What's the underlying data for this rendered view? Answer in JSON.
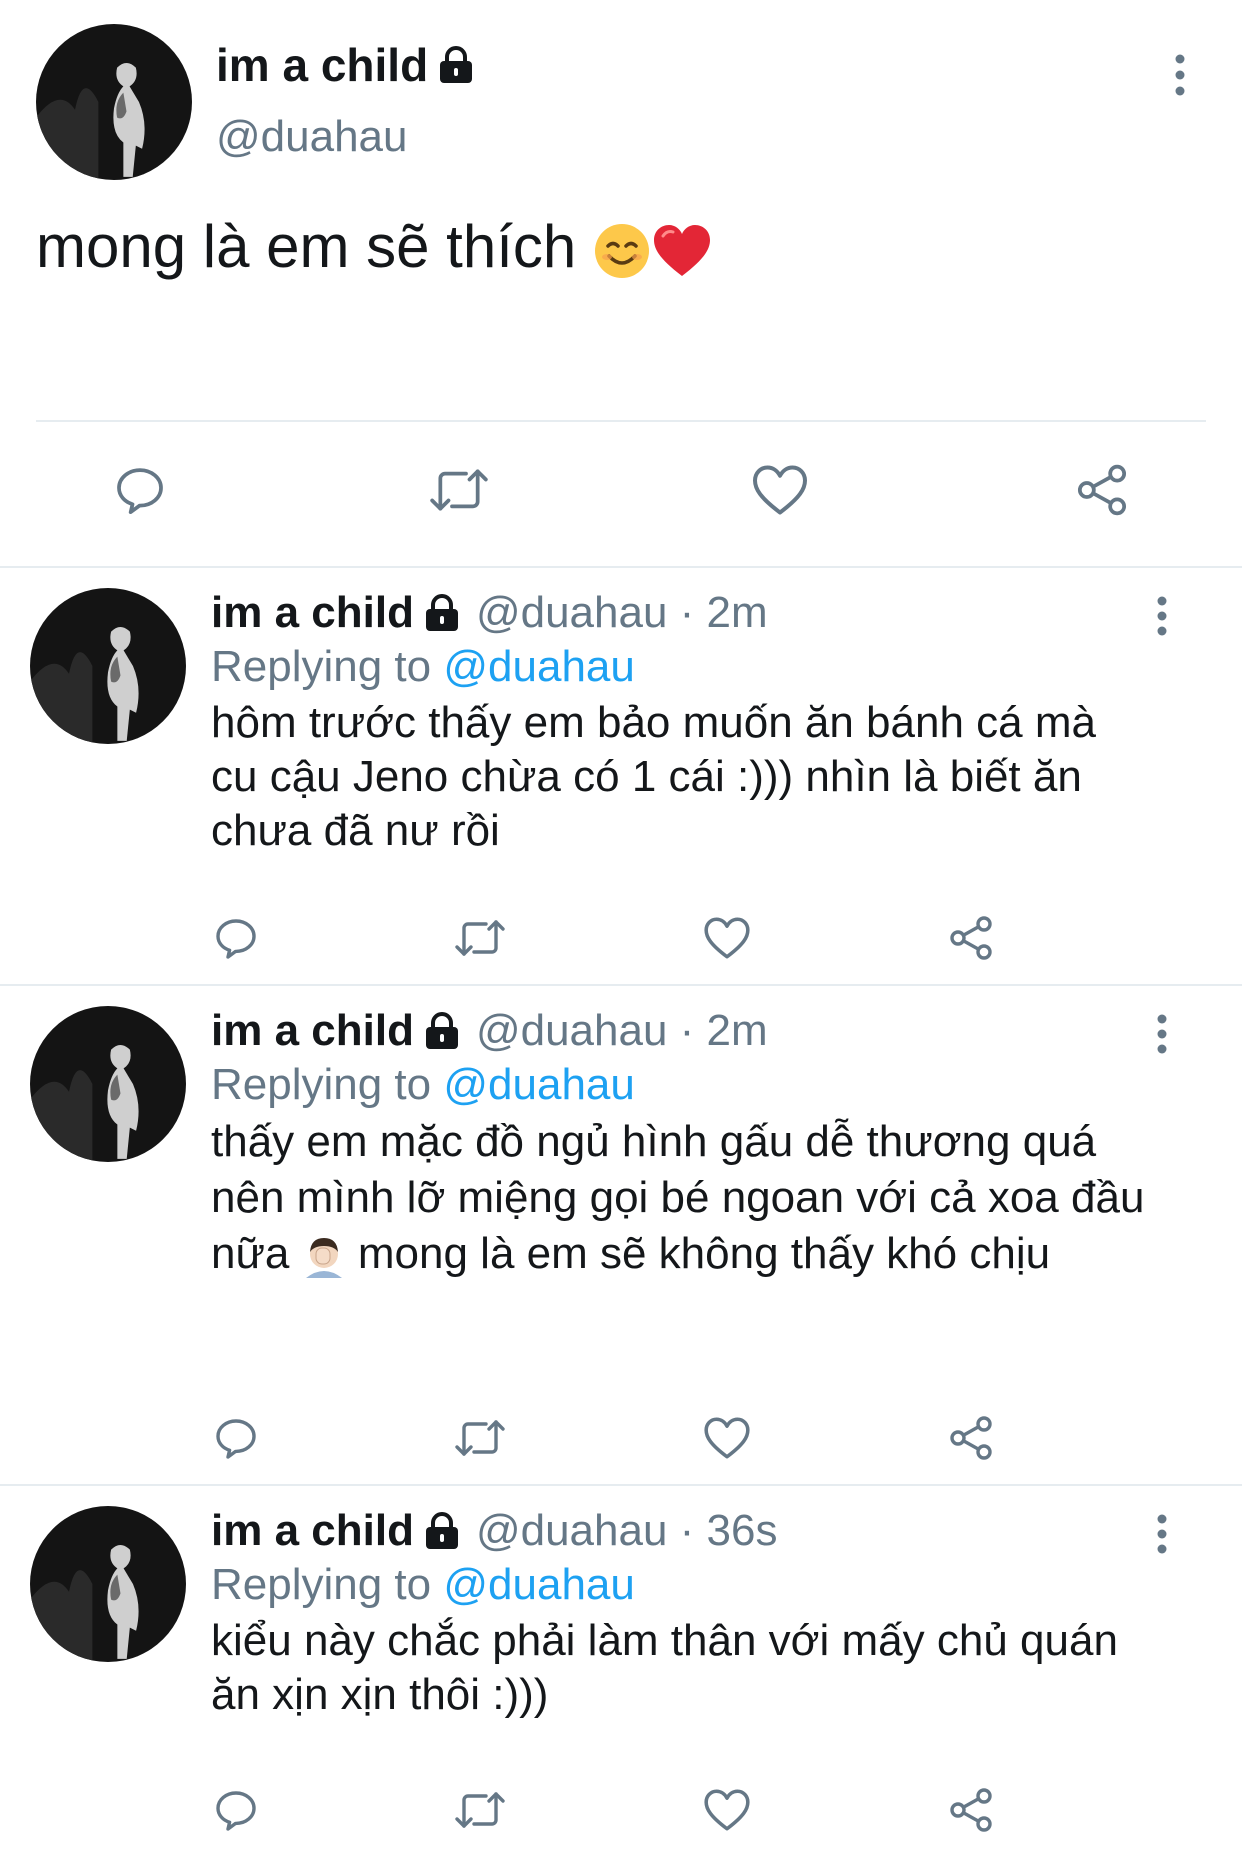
{
  "main_tweet": {
    "display_name": "im a child",
    "handle": "@duahau",
    "text": "mong là em sẽ thích",
    "emojis": [
      "smiling-face-emoji",
      "red-heart-emoji"
    ],
    "actions": [
      "reply-icon",
      "retweet-icon",
      "like-icon",
      "share-icon"
    ]
  },
  "replies": [
    {
      "display_name": "im a child",
      "meta": "@duahau · 2m",
      "replying_prefix": "Replying to",
      "replying_to": "@duahau",
      "text": "hôm trước thấy em bảo muốn ăn bánh cá mà cu cậu Jeno chừa có 1 cái :))) nhìn là biết ăn chưa đã nư rồi"
    },
    {
      "display_name": "im a child",
      "meta": "@duahau · 2m",
      "replying_prefix": "Replying to",
      "replying_to": "@duahau",
      "text_before": "thấy em mặc đồ ngủ hình gấu dễ thương quá nên mình lỡ miệng gọi bé ngoan với cả xoa đầu nữa",
      "text_after": "mong là em sẽ không thấy khó chịu",
      "emoji": "facepalm-emoji"
    },
    {
      "display_name": "im a child",
      "meta": "@duahau · 36s",
      "replying_prefix": "Replying to",
      "replying_to": "@duahau",
      "text": "kiểu này chắc phải làm thân với mấy chủ quán ăn xịn xịn thôi :)))"
    }
  ],
  "colors": {
    "text": "#14171a",
    "secondary": "#657786",
    "link": "#1da1f2",
    "divider": "#e6ecf0",
    "icon": "#657786"
  }
}
